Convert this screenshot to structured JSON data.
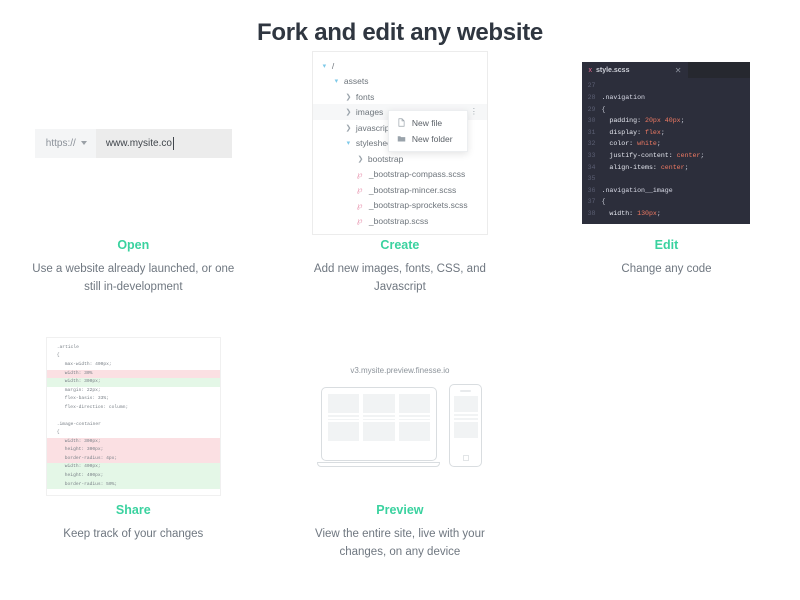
{
  "header": {
    "title": "Fork and edit any website"
  },
  "open_card": {
    "title": "Open",
    "description": "Use a website already launched, or one still in-development",
    "url_bar": {
      "protocol": "https://",
      "value": "www.mysite.co",
      "placeholder": "www.mysite.co"
    }
  },
  "create_card": {
    "title": "Create",
    "description": "Add new images, fonts, CSS, and Javascript",
    "tree": [
      {
        "label": "/",
        "indent": 1,
        "state": "expanded",
        "icon": "chevron-down-icon"
      },
      {
        "label": "assets",
        "indent": 2,
        "state": "expanded",
        "icon": "chevron-down-icon"
      },
      {
        "label": "fonts",
        "indent": 3,
        "state": "collapsed",
        "icon": "chevron-right-icon"
      },
      {
        "label": "images",
        "indent": 3,
        "state": "collapsed",
        "icon": "chevron-right-icon"
      },
      {
        "label": "javascripts",
        "indent": 3,
        "state": "collapsed",
        "icon": "chevron-right-icon"
      },
      {
        "label": "stylesheets",
        "indent": 3,
        "state": "expanded",
        "icon": "chevron-down-icon"
      },
      {
        "label": "bootstrap",
        "indent": 4,
        "state": "collapsed",
        "icon": "chevron-right-icon"
      },
      {
        "label": "_bootstrap-compass.scss",
        "indent": 4,
        "state": "file",
        "icon": "sass-icon"
      },
      {
        "label": "_bootstrap-mincer.scss",
        "indent": 4,
        "state": "file",
        "icon": "sass-icon"
      },
      {
        "label": "_bootstrap-sprockets.scss",
        "indent": 4,
        "state": "file",
        "icon": "sass-icon"
      },
      {
        "label": "_bootstrap.scss",
        "indent": 4,
        "state": "file",
        "icon": "sass-icon"
      }
    ],
    "overflow_icon": "kebab-menu-icon",
    "context_menu": [
      {
        "label": "New file",
        "icon": "file-icon"
      },
      {
        "label": "New folder",
        "icon": "folder-icon"
      }
    ]
  },
  "edit_card": {
    "title": "Edit",
    "description": "Change any code",
    "editor": {
      "tab_name": "style.scss",
      "tab_icon": "sass-icon",
      "close_icon": "close-icon",
      "background": "#2c2e3b",
      "lines": [
        {
          "num": "27",
          "segments": []
        },
        {
          "num": "28",
          "segments": [
            {
              "t": ".navigation",
              "c": "sel"
            }
          ]
        },
        {
          "num": "29",
          "segments": [
            {
              "t": "{",
              "c": "punc"
            }
          ]
        },
        {
          "num": "30",
          "segments": [
            {
              "t": "  padding: ",
              "c": "prop"
            },
            {
              "t": "20px 40px",
              "c": "val"
            },
            {
              "t": ";",
              "c": "punc"
            }
          ]
        },
        {
          "num": "31",
          "segments": [
            {
              "t": "  display: ",
              "c": "prop"
            },
            {
              "t": "flex",
              "c": "val"
            },
            {
              "t": ";",
              "c": "punc"
            }
          ]
        },
        {
          "num": "32",
          "segments": [
            {
              "t": "  color: ",
              "c": "prop"
            },
            {
              "t": "white",
              "c": "val"
            },
            {
              "t": ";",
              "c": "punc"
            }
          ]
        },
        {
          "num": "33",
          "segments": [
            {
              "t": "  justify-content: ",
              "c": "prop"
            },
            {
              "t": "center",
              "c": "val"
            },
            {
              "t": ";",
              "c": "punc"
            }
          ]
        },
        {
          "num": "34",
          "segments": [
            {
              "t": "  align-items: ",
              "c": "prop"
            },
            {
              "t": "center",
              "c": "val"
            },
            {
              "t": ";",
              "c": "punc"
            }
          ]
        },
        {
          "num": "35",
          "segments": []
        },
        {
          "num": "36",
          "segments": [
            {
              "t": ".navigation__image",
              "c": "sel"
            }
          ]
        },
        {
          "num": "37",
          "segments": [
            {
              "t": "{",
              "c": "punc"
            }
          ]
        },
        {
          "num": "38",
          "segments": [
            {
              "t": "  width: ",
              "c": "prop"
            },
            {
              "t": "130px",
              "c": "val"
            },
            {
              "t": ";",
              "c": "punc"
            }
          ]
        }
      ]
    }
  },
  "share_card": {
    "title": "Share",
    "description": "Keep track of your changes",
    "diff": [
      {
        "text": ".article",
        "type": "ctx",
        "indent": 0
      },
      {
        "text": "{",
        "type": "ctx",
        "indent": 0
      },
      {
        "text": "max-width: 400px;",
        "type": "ctx",
        "indent": 1
      },
      {
        "text": "width: 30%",
        "type": "del",
        "indent": 1
      },
      {
        "text": "width: 300px;",
        "type": "add",
        "indent": 1
      },
      {
        "text": "margin: 22px;",
        "type": "ctx",
        "indent": 1
      },
      {
        "text": "flex-basis: 33%;",
        "type": "ctx",
        "indent": 1
      },
      {
        "text": "flex-direction: column;",
        "type": "ctx",
        "indent": 1
      },
      {
        "text": "",
        "type": "gap",
        "indent": 0
      },
      {
        "text": ".image-container",
        "type": "ctx",
        "indent": 0
      },
      {
        "text": "{",
        "type": "ctx",
        "indent": 0
      },
      {
        "text": "width: 300px;",
        "type": "del",
        "indent": 1
      },
      {
        "text": "height: 300px;",
        "type": "del",
        "indent": 1
      },
      {
        "text": "border-radius: 4px;",
        "type": "del",
        "indent": 1
      },
      {
        "text": "width: 400px;",
        "type": "add",
        "indent": 1
      },
      {
        "text": "height: 400px;",
        "type": "add",
        "indent": 1
      },
      {
        "text": "border-radius: 50%;",
        "type": "add",
        "indent": 1
      }
    ],
    "colors": {
      "added": "#e4f7e7",
      "removed": "#fbe0e3"
    }
  },
  "preview_card": {
    "title": "Preview",
    "description": "View the entire site, live with your changes, on any device",
    "preview_url": "v3.mysite.preview.finesse.io",
    "devices": [
      "laptop",
      "phone"
    ]
  },
  "theme": {
    "accent": "#3ad29f",
    "text": "#3d4852",
    "muted": "#6f7780"
  }
}
